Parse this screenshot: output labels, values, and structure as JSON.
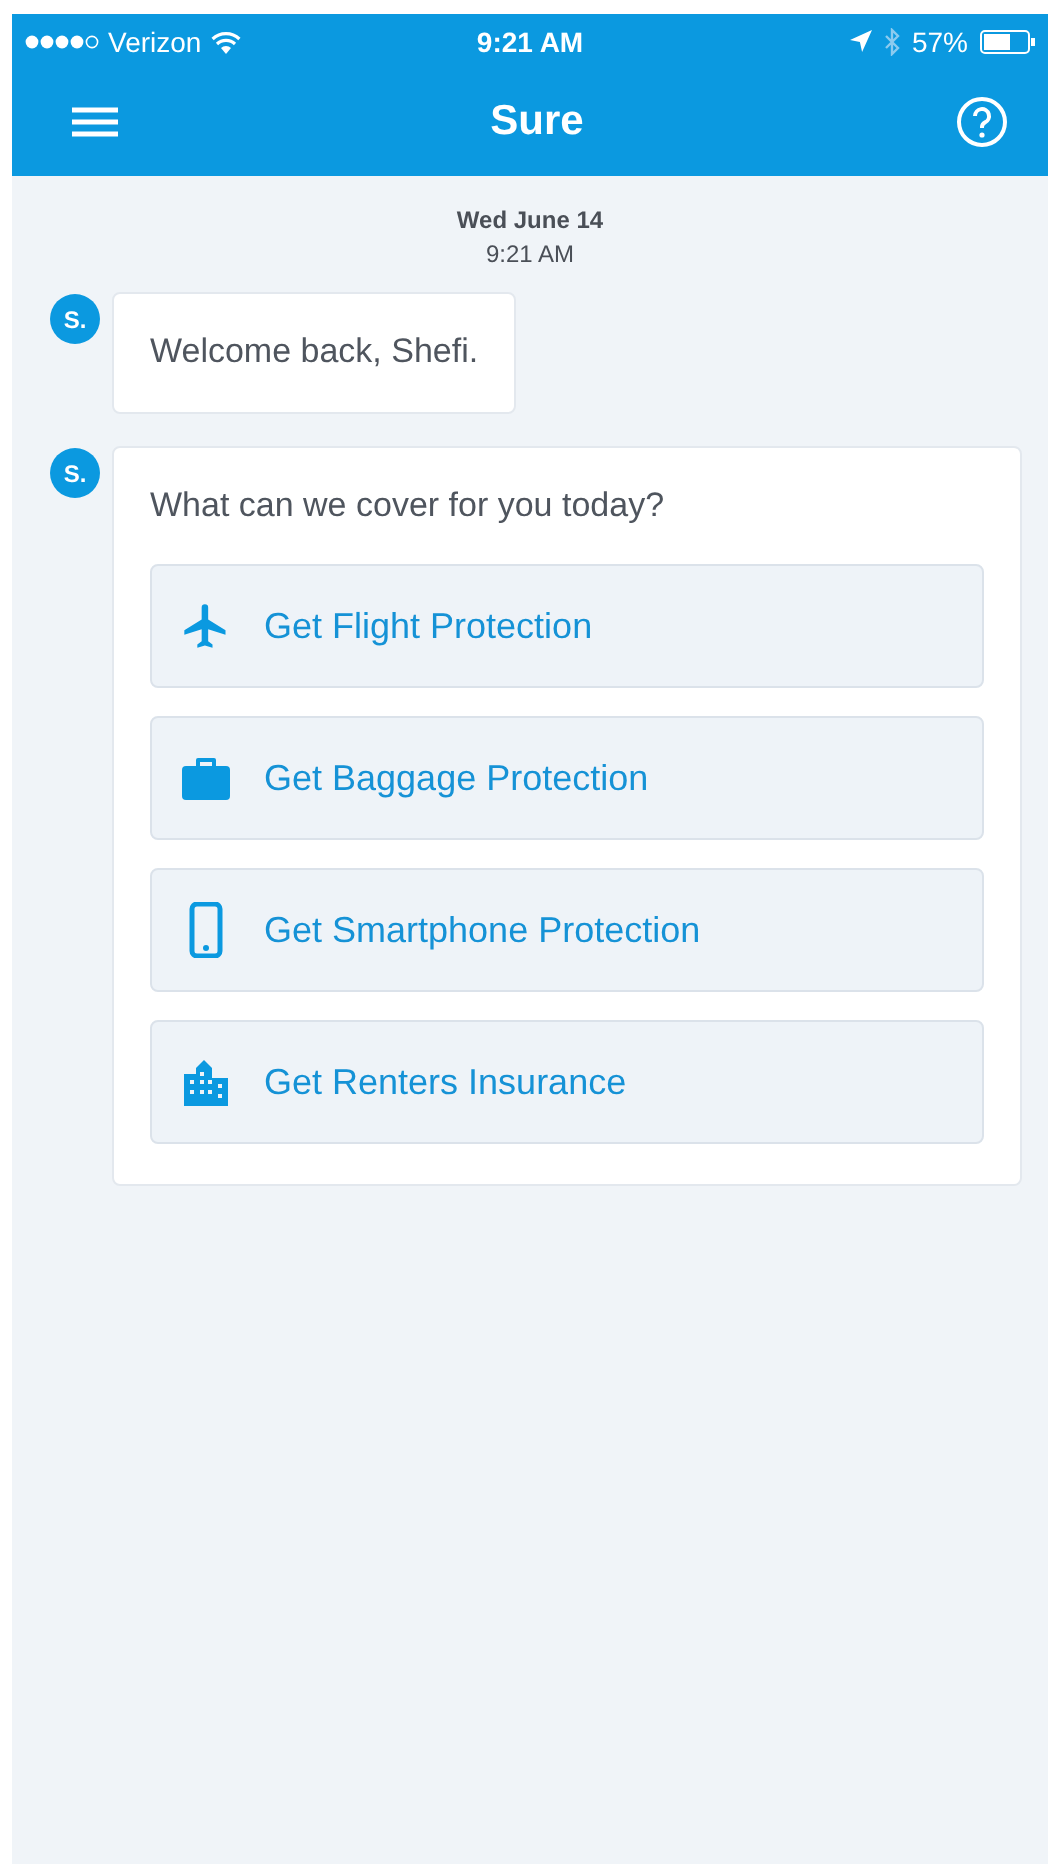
{
  "status_bar": {
    "carrier": "Verizon",
    "time": "9:21 AM",
    "battery": "57%"
  },
  "nav_bar": {
    "title": "Sure"
  },
  "timestamp": {
    "date": "Wed June 14",
    "time": "9:21 AM"
  },
  "messages": [
    {
      "avatar": "S.",
      "text": "Welcome back, Shefi."
    },
    {
      "avatar": "S.",
      "text": "What can we cover for you today?",
      "options": [
        {
          "kind": "flight",
          "label": "Get Flight Protection"
        },
        {
          "kind": "baggage",
          "label": "Get Baggage Protection"
        },
        {
          "kind": "smartphone",
          "label": "Get Smartphone Protection"
        },
        {
          "kind": "renters",
          "label": "Get Renters Insurance"
        }
      ]
    }
  ]
}
